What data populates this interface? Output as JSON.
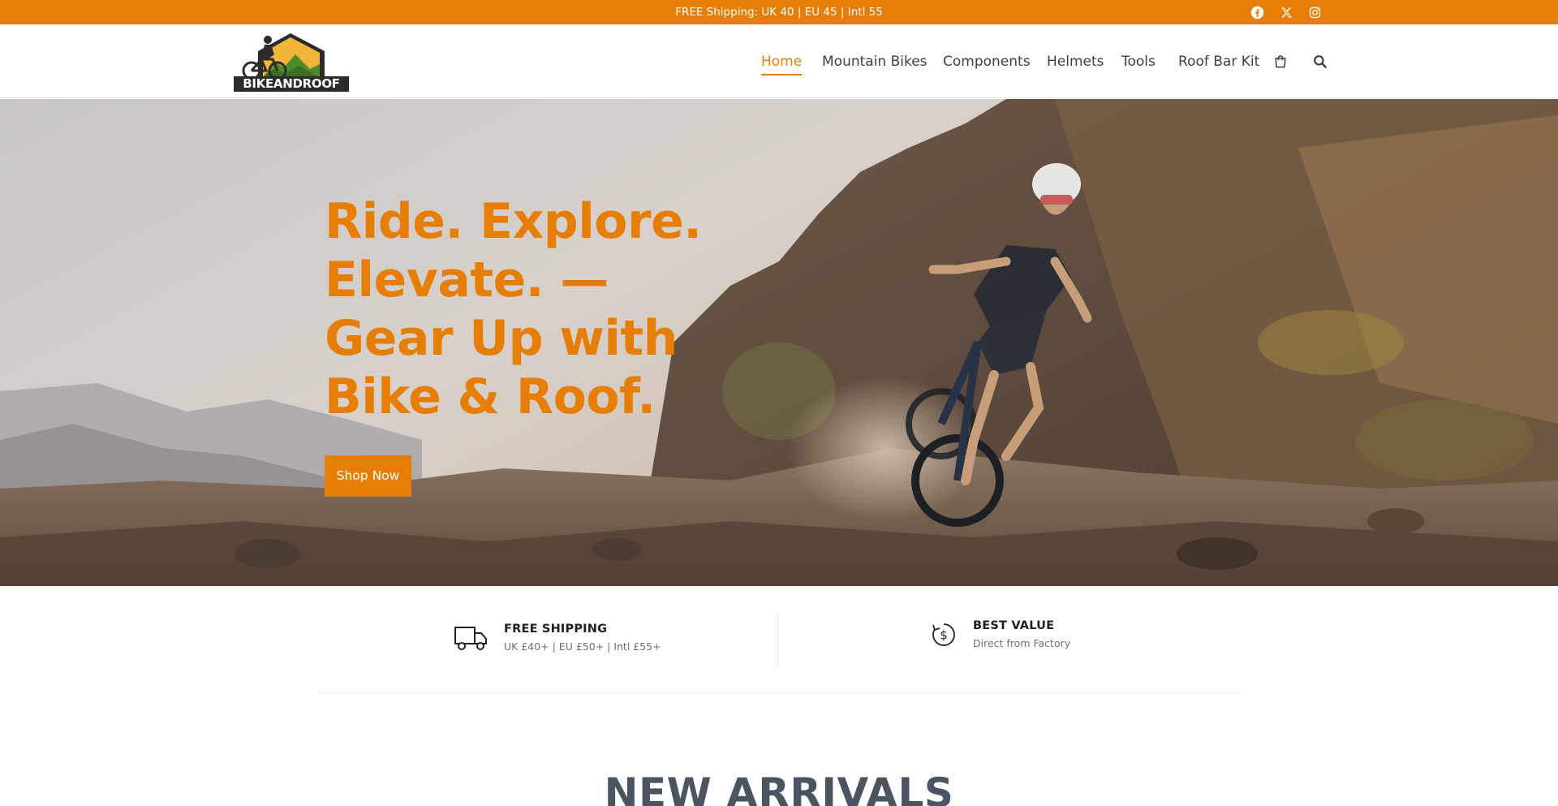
{
  "topbar": {
    "promo": "FREE Shipping: UK   40 | EU   45 | Intl   55",
    "social": [
      "facebook-icon",
      "x-twitter-icon",
      "instagram-icon"
    ],
    "background": "#e67e05"
  },
  "header": {
    "logo_text": "BIKEANDROOF",
    "nav": [
      {
        "label": "Home",
        "active": true
      },
      {
        "label": "Mountain Bikes",
        "active": false
      },
      {
        "label": "Components",
        "active": false
      },
      {
        "label": "Helmets",
        "active": false
      },
      {
        "label": "Tools",
        "active": false
      },
      {
        "label": "Roof Bar Kit",
        "active": false
      }
    ],
    "icons": [
      "shopping-bag-icon",
      "search-icon"
    ]
  },
  "hero": {
    "title_lines": [
      "Ride. Explore.",
      "Elevate. —",
      "Gear Up with",
      "Bike & Roof."
    ],
    "button_label": "Shop Now",
    "accent": "#e67e05"
  },
  "features": [
    {
      "icon": "truck-icon",
      "title": "FREE SHIPPING",
      "subtitle": "UK £40+ | EU £50+ | Intl £55+"
    },
    {
      "icon": "dollar-cycle-icon",
      "title": "BEST VALUE",
      "subtitle": "Direct from Factory"
    }
  ],
  "section": {
    "title": "NEW ARRIVALS"
  }
}
